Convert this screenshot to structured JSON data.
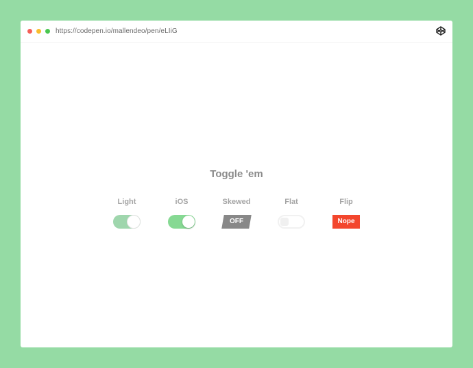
{
  "browser": {
    "url": "https://codepen.io/mallendeo/pen/eLIiG",
    "dots": [
      "#f55f58",
      "#f9be2e",
      "#4ac750"
    ],
    "icon": "codepen-icon"
  },
  "page": {
    "title": "Toggle 'em"
  },
  "toggles": [
    {
      "label": "Light",
      "state": "on",
      "color": "#9fd6ad"
    },
    {
      "label": "iOS",
      "state": "on",
      "color": "#86d993"
    },
    {
      "label": "Skewed",
      "state": "off",
      "text": "OFF",
      "color": "#888888"
    },
    {
      "label": "Flat",
      "state": "off",
      "color": "#f1f1f1"
    },
    {
      "label": "Flip",
      "state": "off",
      "text": "Nope",
      "color": "#f3462d"
    }
  ]
}
